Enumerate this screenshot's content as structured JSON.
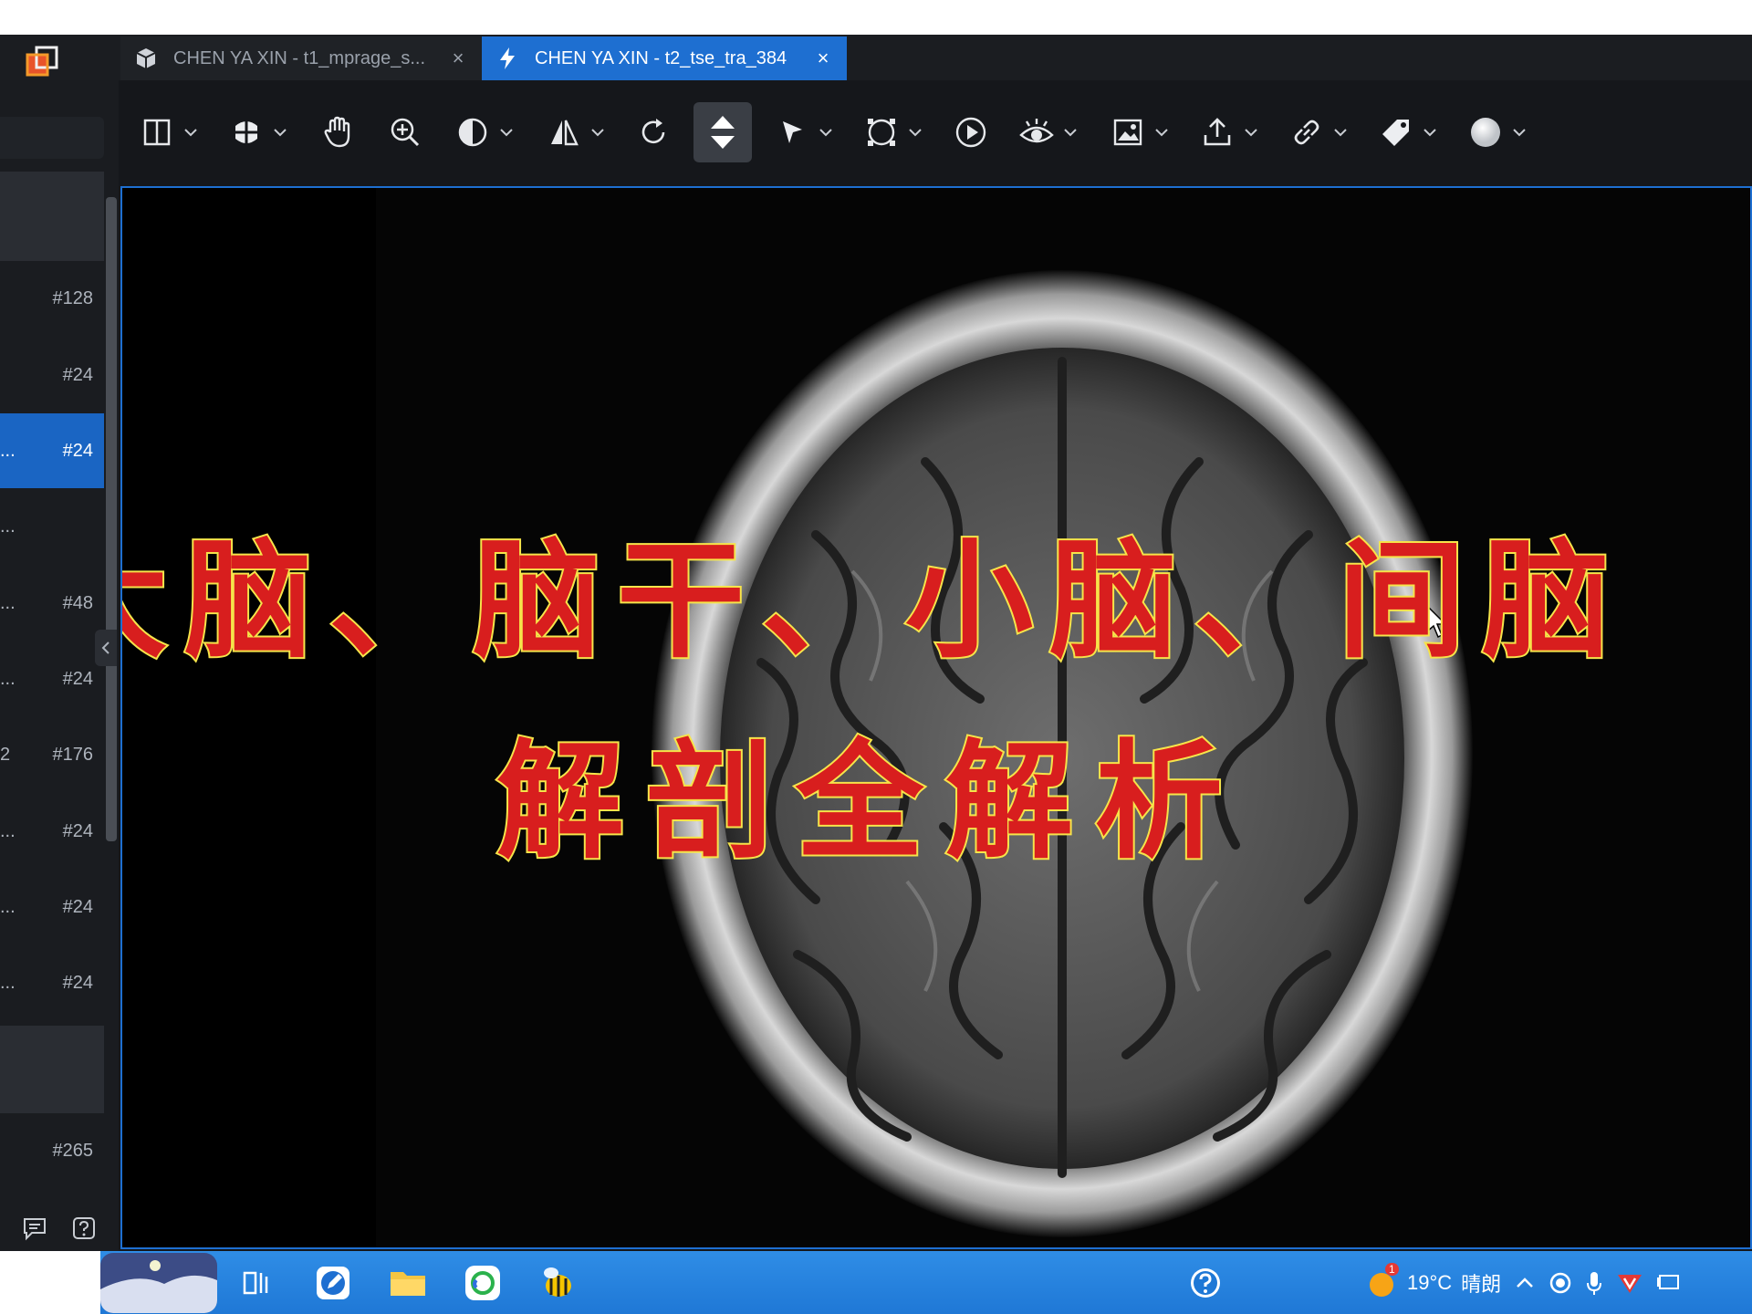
{
  "tabs": [
    {
      "label": "CHEN YA XIN - t1_mprage_s...",
      "icon": "cube-icon",
      "active": false
    },
    {
      "label": "CHEN YA XIN - t2_tse_tra_384",
      "icon": "lightning-icon",
      "active": true
    }
  ],
  "tab_close_glyph": "×",
  "toolbar": {
    "tools": [
      "layout-icon",
      "3d-view-icon",
      "pan-hand-icon",
      "zoom-icon",
      "contrast-icon",
      "flip-icon",
      "rotate-icon",
      "scroll-stack-icon",
      "pointer-icon",
      "roi-icon",
      "play-icon",
      "eye-icon",
      "image-icon",
      "export-icon",
      "link-icon",
      "tag-icon",
      "circle-icon"
    ],
    "active_tool": "scroll-stack-icon"
  },
  "sidebar": {
    "series": [
      {
        "prefix": "",
        "count": "#128"
      },
      {
        "prefix": "",
        "count": "#24"
      },
      {
        "prefix": "...",
        "count": "#24",
        "active": true
      },
      {
        "prefix": "...",
        "count": ""
      },
      {
        "prefix": "...",
        "count": "#48"
      },
      {
        "prefix": "...",
        "count": "#24"
      },
      {
        "prefix": "2",
        "count": "#176"
      },
      {
        "prefix": "...",
        "count": "#24"
      },
      {
        "prefix": "...",
        "count": "#24"
      },
      {
        "prefix": "...",
        "count": "#24"
      }
    ],
    "bottom_count": "#265",
    "footer_icons": [
      "comment-icon",
      "help-icon"
    ]
  },
  "overlay": {
    "line1": "大脑、脑干、小脑、间脑",
    "line2": "解剖全解析"
  },
  "taskbar": {
    "weather_temp": "19°C",
    "weather_text": "晴朗",
    "weather_badge": "1"
  },
  "colors": {
    "accent": "#1e6fd1",
    "overlay_fill": "#d81e1e",
    "overlay_stroke": "#f6e44a",
    "taskbar": "#2a87e3"
  }
}
